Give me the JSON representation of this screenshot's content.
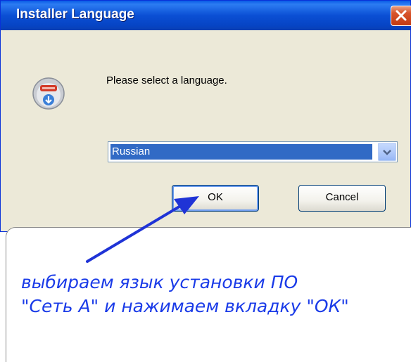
{
  "window": {
    "title": "Installer Language"
  },
  "dialog": {
    "prompt": "Please select a language.",
    "language_select": {
      "selected": "Russian"
    },
    "buttons": {
      "ok": "OK",
      "cancel": "Cancel"
    }
  },
  "annotation": {
    "line1": "выбираем язык установки ПО",
    "line2": "\"Сеть А\" и нажимаем вкладку \"ОК\""
  },
  "icons": {
    "close": "close-icon",
    "app": "installer-icon",
    "dropdown": "chevron-down-icon",
    "arrow": "arrow-icon"
  },
  "colors": {
    "titlebar": "#0b4fd4",
    "selection": "#316ac5",
    "annotation_text": "#1a3be8",
    "close_button": "#c43b12"
  }
}
